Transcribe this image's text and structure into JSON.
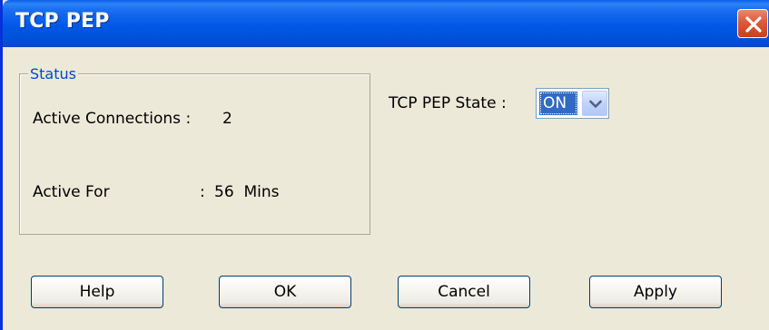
{
  "window": {
    "title": "TCP PEP"
  },
  "title_bar": {
    "close_icon": "close-icon"
  },
  "status_group": {
    "legend": "Status",
    "active_connections_label": "Active Connections :",
    "active_connections_value": "2",
    "active_for_label": "Active For",
    "active_for_separator": ":",
    "active_for_value": "56  Mins"
  },
  "tcp_pep_state": {
    "label": "TCP PEP State :",
    "selected": "ON",
    "dropdown_icon": "chevron-down-icon"
  },
  "buttons": {
    "help": "Help",
    "ok": "OK",
    "cancel": "Cancel",
    "apply": "Apply"
  },
  "colors": {
    "title_bar": "#0058e6",
    "dialog_background": "#ece9d8",
    "group_legend": "#0046d5",
    "selection": "#316ac5",
    "close_button": "#e0573a"
  }
}
